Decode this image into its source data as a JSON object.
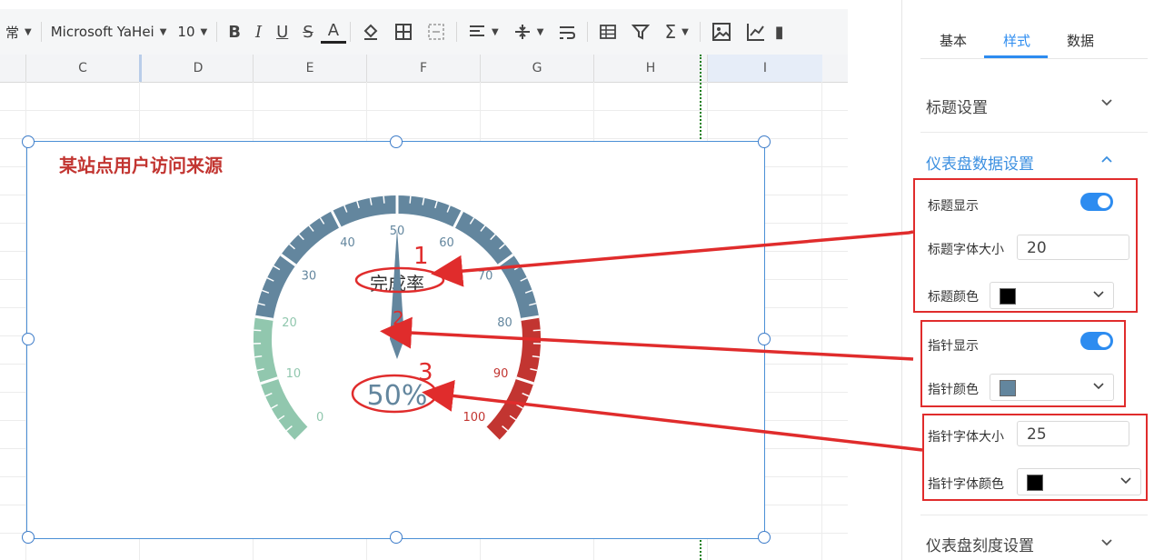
{
  "toolbar": {
    "style_partial": "常",
    "font_name": "Microsoft YaHei",
    "font_size": "10"
  },
  "columns": [
    "C",
    "D",
    "E",
    "F",
    "G",
    "H",
    "I"
  ],
  "chart": {
    "title": "某站点用户访问来源",
    "gauge_name": "完成率",
    "gauge_value_text": "50%",
    "value": 50,
    "min": 0,
    "max": 100,
    "tick_labels": [
      "0",
      "10",
      "20",
      "30",
      "40",
      "50",
      "60",
      "70",
      "80",
      "90",
      "100"
    ],
    "colors": {
      "low": "#91c7ae",
      "mid": "#63869e",
      "high": "#c23531",
      "title": "#c23531",
      "pointer": "#63869e"
    },
    "bands": [
      {
        "to": 0.2,
        "color": "#91c7ae"
      },
      {
        "to": 0.8,
        "color": "#63869e"
      },
      {
        "to": 1.0,
        "color": "#c23531"
      }
    ]
  },
  "annotations": [
    "1",
    "2",
    "3"
  ],
  "panel": {
    "tabs": [
      "基本",
      "样式",
      "数据"
    ],
    "active_tab": "样式",
    "sections": {
      "title_settings": "标题设置",
      "gauge_data_settings": "仪表盘数据设置",
      "gauge_scale_settings": "仪表盘刻度设置"
    },
    "fields": {
      "title_show": "标题显示",
      "title_font_size": "标题字体大小",
      "title_font_size_value": "20",
      "title_color": "标题颜色",
      "title_color_value": "#000000",
      "pointer_show": "指针显示",
      "pointer_color": "指针颜色",
      "pointer_color_value": "#63869e",
      "pointer_font_size": "指针字体大小",
      "pointer_font_size_value": "25",
      "pointer_font_color": "指针字体颜色",
      "pointer_font_color_value": "#000000"
    }
  }
}
